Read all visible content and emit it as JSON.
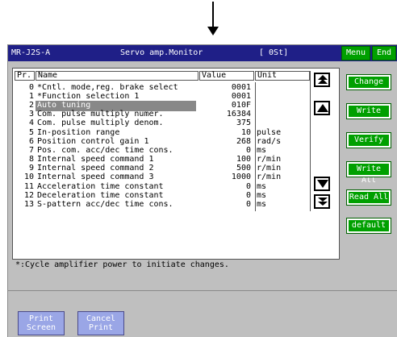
{
  "title_bar": {
    "model": "MR-J2S-A",
    "screen_name": "Servo amp.Monitor",
    "station": "[ 0St]",
    "menu_label": "Menu",
    "end_label": "End"
  },
  "table": {
    "headers": {
      "pr": "Pr.",
      "name": "Name",
      "value": "Value",
      "unit": "Unit"
    },
    "rows": [
      {
        "pr": "0",
        "name": "*Cntl. mode,reg. brake select",
        "value": "0001",
        "unit": ""
      },
      {
        "pr": "1",
        "name": "*Function selection 1",
        "value": "0001",
        "unit": ""
      },
      {
        "pr": "2",
        "name": "Auto tuning",
        "value": "010F",
        "unit": ""
      },
      {
        "pr": "3",
        "name": "Com. pulse multiply numer.",
        "value": "16384",
        "unit": ""
      },
      {
        "pr": "4",
        "name": "Com. pulse multiply denom.",
        "value": "375",
        "unit": ""
      },
      {
        "pr": "5",
        "name": "In-position range",
        "value": "10",
        "unit": "pulse"
      },
      {
        "pr": "6",
        "name": "Position control gain 1",
        "value": "268",
        "unit": "rad/s"
      },
      {
        "pr": "7",
        "name": "Pos. com. acc/dec time cons.",
        "value": "0",
        "unit": "ms"
      },
      {
        "pr": "8",
        "name": "Internal speed command 1",
        "value": "100",
        "unit": "r/min"
      },
      {
        "pr": "9",
        "name": "Internal speed command 2",
        "value": "500",
        "unit": "r/min"
      },
      {
        "pr": "10",
        "name": "Internal speed command 3",
        "value": "1000",
        "unit": "r/min"
      },
      {
        "pr": "11",
        "name": "Acceleration time constant",
        "value": "0",
        "unit": "ms"
      },
      {
        "pr": "12",
        "name": "Deceleration time constant",
        "value": "0",
        "unit": "ms"
      },
      {
        "pr": "13",
        "name": "S-pattern acc/dec time cons.",
        "value": "0",
        "unit": "ms"
      }
    ],
    "selected_row": "2"
  },
  "side_buttons": {
    "change": "Change",
    "write": "Write",
    "verify": "Verify",
    "write_all": "Write All",
    "read_all": "Read All",
    "default": "default"
  },
  "note": "*:Cycle amplifier power to initiate changes.",
  "bottom_buttons": {
    "print_screen_line1": "Print",
    "print_screen_line2": "Screen",
    "cancel_print_line1": "Cancel",
    "cancel_print_line2": "Print"
  },
  "colors": {
    "title_bar": "#1f1f87",
    "button_green": "#00a000",
    "screen_bg": "#bfbfbf",
    "selection": "#888888",
    "bottom_button": "#9aa6e6"
  },
  "icons": {
    "top_arrow": "down-arrow-icon",
    "page_up": "double-up-arrow-icon",
    "line_up": "up-arrow-icon",
    "line_down": "down-arrow-icon",
    "page_down": "double-down-arrow-icon"
  }
}
